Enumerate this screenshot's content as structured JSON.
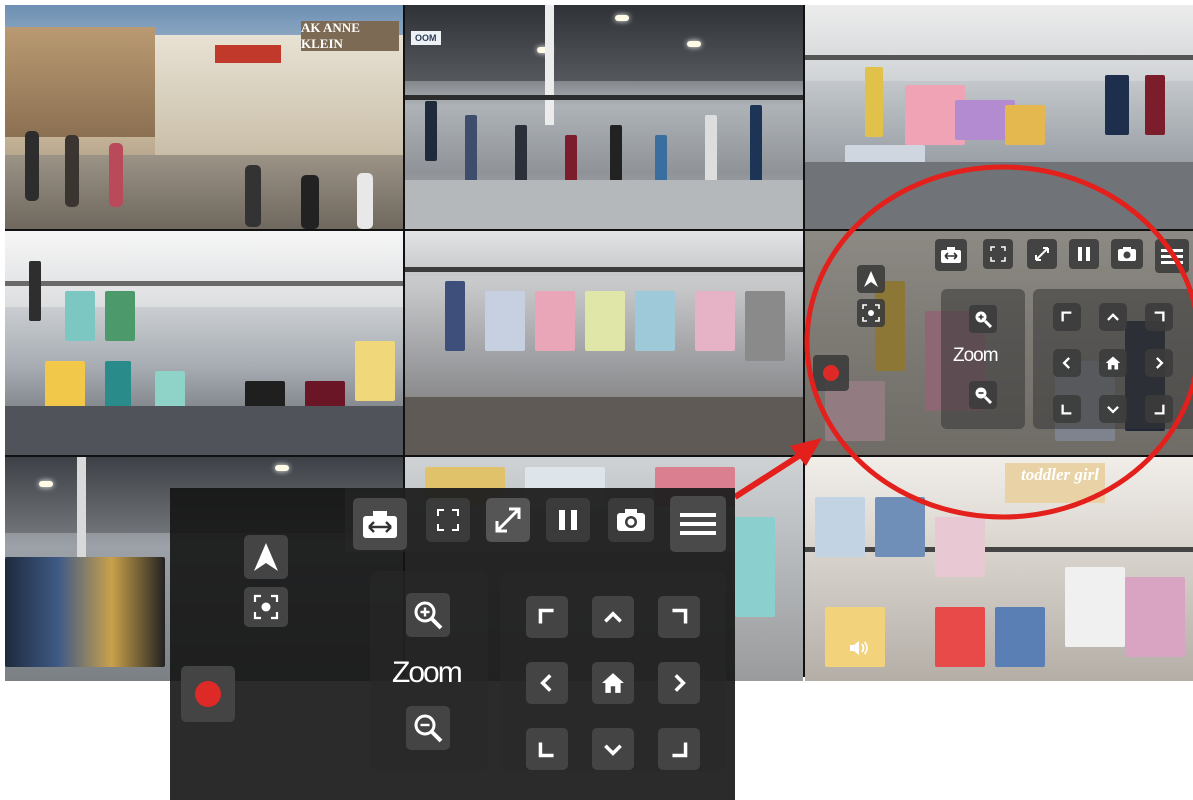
{
  "cameras": [
    {
      "id": "cam-1",
      "sign_main": "AK ANNE KLEIN",
      "sign_secondary": ""
    },
    {
      "id": "cam-2",
      "sign_main": "OOM"
    },
    {
      "id": "cam-3"
    },
    {
      "id": "cam-4"
    },
    {
      "id": "cam-5"
    },
    {
      "id": "cam-6"
    },
    {
      "id": "cam-7"
    },
    {
      "id": "cam-8"
    },
    {
      "id": "cam-9",
      "sign_main": "toddler girl"
    }
  ],
  "toolbar": {
    "swap_icon": "camera-swap-icon",
    "fullscreen_icon": "fullscreen-icon",
    "fit_icon": "fit-diagonal-icon",
    "pause_icon": "pause-icon",
    "snapshot_icon": "camera-snapshot-icon",
    "menu_icon": "hamburger-menu-icon"
  },
  "controls": {
    "navigate_icon": "navigation-arrow-icon",
    "focus_icon": "focus-target-icon",
    "record_icon": "record-icon",
    "zoom_label": "Zoom",
    "zoom_in_icon": "zoom-in-icon",
    "zoom_out_icon": "zoom-out-icon"
  },
  "ptz_pad": {
    "up_left": "corner-up-left-icon",
    "up": "chevron-up-icon",
    "up_right": "corner-up-right-icon",
    "left": "chevron-left-icon",
    "home": "home-icon",
    "right": "chevron-right-icon",
    "down_left": "corner-down-left-icon",
    "down": "chevron-down-icon",
    "down_right": "corner-down-right-icon"
  },
  "audio": {
    "speaker_icon": "speaker-icon"
  },
  "colors": {
    "highlight": "#e3201b",
    "record": "#dd2a26",
    "panel_bg": "#141414",
    "button_bg": "#3b3b3b"
  }
}
